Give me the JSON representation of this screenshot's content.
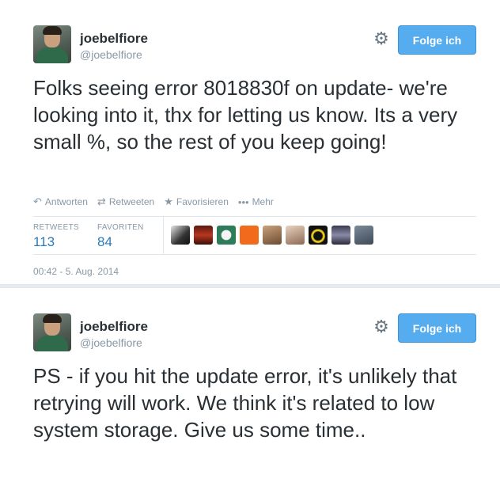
{
  "tweets": [
    {
      "display_name": "joebelfiore",
      "screen_name": "@joebelfiore",
      "follow_label": "Folge ich",
      "text": "Folks seeing error 8018830f on update- we're looking into it, thx for letting us know.  Its a very small %, so the rest of you keep going!",
      "actions": {
        "reply": "Antworten",
        "retweet": "Retweeten",
        "favorite": "Favorisieren",
        "more": "Mehr"
      },
      "stats": {
        "retweets_label": "RETWEETS",
        "retweets": "113",
        "favorites_label": "FAVORITEN",
        "favorites": "84"
      },
      "timestamp": "00:42 - 5. Aug. 2014"
    },
    {
      "display_name": "joebelfiore",
      "screen_name": "@joebelfiore",
      "follow_label": "Folge ich",
      "text": "PS - if you hit the update error, it's unlikely that retrying will work. We think it's related to low system storage. Give us some time.."
    }
  ],
  "icons": {
    "settings": "gear-icon",
    "reply": "reply-icon",
    "retweet": "retweet-icon",
    "favorite": "star-icon",
    "more": "more-dots-icon"
  },
  "colors": {
    "follow_button": "#55acee",
    "stat_value": "#2b7bb9",
    "muted": "#8899a6"
  }
}
